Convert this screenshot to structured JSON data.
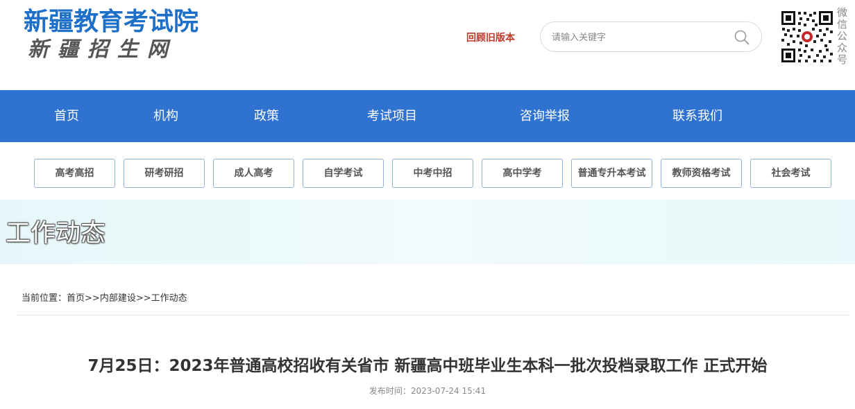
{
  "header": {
    "logo_title": "新疆教育考试院",
    "logo_subtitle": "新疆招生网",
    "old_version_link": "回顾旧版本",
    "search_placeholder": "请输入关键字",
    "qr_label": "微信公众号"
  },
  "nav": {
    "items": [
      "首页",
      "机构",
      "政策",
      "考试项目",
      "咨询举报",
      "联系我们"
    ]
  },
  "categories": [
    "高考高招",
    "研考研招",
    "成人高考",
    "自学考试",
    "中考中招",
    "高中学考",
    "普通专升本考试",
    "教师资格考试",
    "社会考试"
  ],
  "banner": {
    "title": "工作动态"
  },
  "breadcrumb": {
    "prefix": "当前位置：",
    "home": "首页",
    "sep1": ">>",
    "section": "内部建设",
    "sep2": ">>",
    "current": "工作动态"
  },
  "article": {
    "title": "7月25日：2023年普通高校招收有关省市 新疆高中班毕业生本科一批次投档录取工作 正式开始",
    "meta_label": "发布时间：",
    "publish_time": "2023-07-24 15:41"
  },
  "colors": {
    "brand_blue": "#2f72cf",
    "logo_blue": "#1e6fc8",
    "link_red": "#c0392b",
    "banner_bg": "#e7f7f9"
  }
}
